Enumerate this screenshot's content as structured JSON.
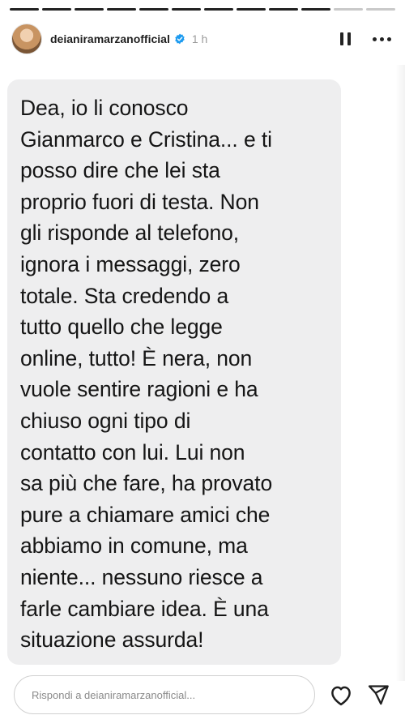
{
  "story": {
    "progress_segments": 12,
    "active_segment_index": 10
  },
  "header": {
    "username": "deianiramarzanofficial",
    "time": "1 h",
    "icons": {
      "avatar": "profile-avatar",
      "verified": "verified-badge-icon",
      "pause": "pause-icon",
      "more": "more-options-icon"
    }
  },
  "message": {
    "text": "Dea, io li conosco\nGianmarco  e Cristina... e ti\nposso dire che lei sta\nproprio fuori di testa. Non\ngli risponde al telefono,\nignora i messaggi, zero\ntotale. Sta credendo a\ntutto quello che legge\nonline, tutto! È nera, non\nvuole sentire ragioni e ha\nchiuso ogni tipo di\ncontatto con lui. Lui non\nsa più che fare, ha provato\npure a chiamare amici che\nabbiamo in comune, ma\nniente... nessuno riesce a\nfarle cambiare idea. È una\nsituazione assurda!"
  },
  "footer": {
    "reply_placeholder": "Rispondi a deianiramarzanofficial...",
    "icons": {
      "like": "heart-icon",
      "share": "send-icon"
    }
  },
  "colors": {
    "bubble": "#eeeeef",
    "progress_active": "#222222",
    "progress_inactive": "#c9c9c9",
    "verified": "#1d9bf0"
  }
}
